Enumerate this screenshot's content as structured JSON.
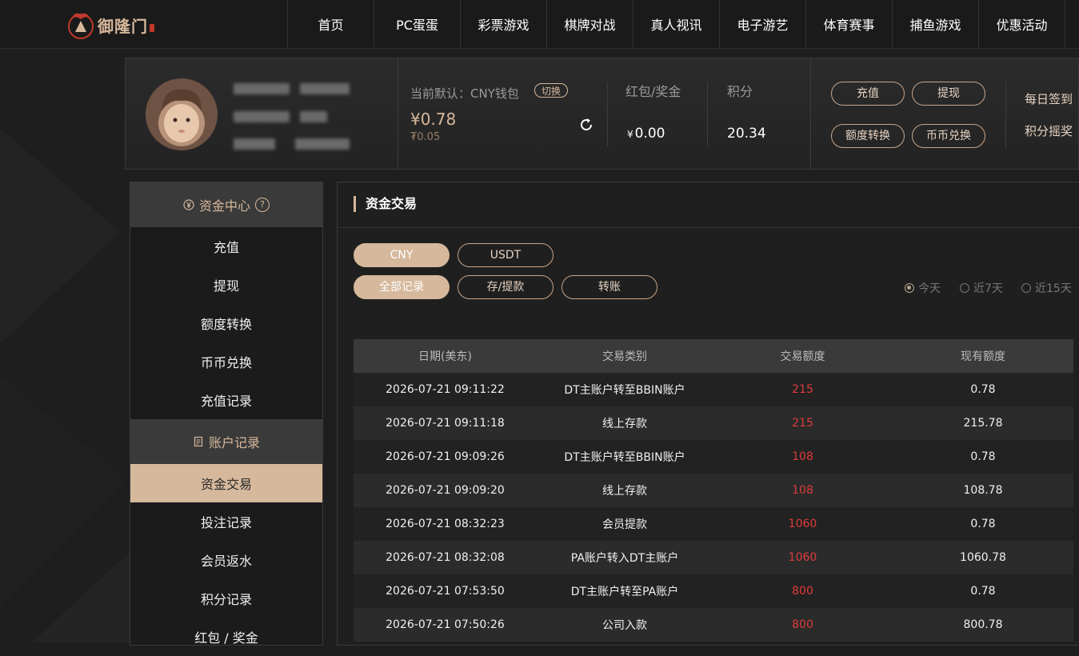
{
  "logo": {
    "text": "御隆门"
  },
  "nav": [
    "首页",
    "PC蛋蛋",
    "彩票游戏",
    "棋牌对战",
    "真人视讯",
    "电子游艺",
    "体育赛事",
    "捕鱼游戏",
    "优惠活动"
  ],
  "account": {
    "wallet_label": "当前默认：CNY钱包",
    "switch_label": "切换",
    "balance": "¥0.78",
    "sub_balance": "₮0.05",
    "bonus_label": "红包/奖金",
    "bonus_currency": "¥",
    "bonus_value": "0.00",
    "points_label": "积分",
    "points_value": "20.34",
    "buttons": {
      "deposit": "充值",
      "withdraw": "提现",
      "transfer": "额度转换",
      "exchange": "币币兑换"
    },
    "links": {
      "checkin": "每日签到",
      "lottery": "积分摇奖"
    }
  },
  "sidebar": {
    "fund_center": "资金中心",
    "fund_items": [
      "充值",
      "提现",
      "额度转换",
      "币币兑换",
      "充值记录"
    ],
    "account_records": "账户记录",
    "record_items": [
      "资金交易",
      "投注记录",
      "会员返水",
      "积分记录",
      "红包 / 奖金"
    ],
    "active": "资金交易"
  },
  "main": {
    "title": "资金交易",
    "currency_tabs": [
      "CNY",
      "USDT"
    ],
    "type_tabs": [
      "全部记录",
      "存/提款",
      "转账"
    ],
    "ranges": [
      "今天",
      "近7天",
      "近15天"
    ],
    "selected_range": "今天"
  },
  "table": {
    "headers": [
      "日期(美东)",
      "交易类别",
      "交易额度",
      "现有额度"
    ],
    "rows": [
      [
        "2026-07-21 09:11:22",
        "DT主账户转至BBIN账户",
        "215",
        "0.78"
      ],
      [
        "2026-07-21 09:11:18",
        "线上存款",
        "215",
        "215.78"
      ],
      [
        "2026-07-21 09:09:26",
        "DT主账户转至BBIN账户",
        "108",
        "0.78"
      ],
      [
        "2026-07-21 09:09:20",
        "线上存款",
        "108",
        "108.78"
      ],
      [
        "2026-07-21 08:32:23",
        "会员提款",
        "1060",
        "0.78"
      ],
      [
        "2026-07-21 08:32:08",
        "PA账户转入DT主账户",
        "1060",
        "1060.78"
      ],
      [
        "2026-07-21 07:53:50",
        "DT主账户转至PA账户",
        "800",
        "0.78"
      ],
      [
        "2026-07-21 07:50:26",
        "公司入款",
        "800",
        "800.78"
      ]
    ]
  },
  "colors": {
    "accent": "#d6b89c",
    "negative": "#e03a3a",
    "background": "#1e1e1e"
  }
}
